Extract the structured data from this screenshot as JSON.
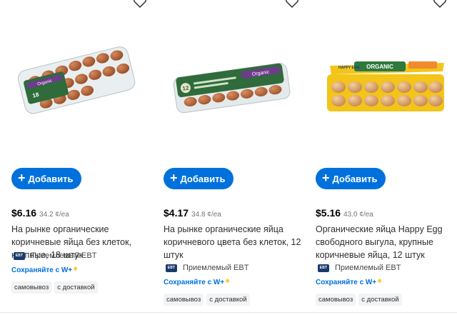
{
  "products": [
    {
      "price": "$6.16",
      "unit_price": "34.2 ¢/ea",
      "title": "На рынке органические коричневые яйца без клеток, крупные, 18 штук",
      "add_label": "Добавить",
      "ebt_badge": "EBT",
      "ebt_label": "Приемлемый EBT",
      "save_label": "Сохраняйте с W+",
      "chips": [
        "самовывоз",
        "с доставкой"
      ],
      "image": {
        "pack_label": "Organic",
        "count_label": "18"
      }
    },
    {
      "price": "$4.17",
      "unit_price": "34.8 ¢/ea",
      "title": "На рынке органические яйца коричневого цвета без клеток, 12 штук",
      "add_label": "Добавить",
      "ebt_badge": "EBT",
      "ebt_label": "Приемлемый EBT",
      "save_label": "Сохраняйте с W+",
      "chips": [
        "самовывоз",
        "с доставкой"
      ],
      "image": {
        "pack_label": "Organic",
        "count_label": "12"
      }
    },
    {
      "price": "$5.16",
      "unit_price": "43.0 ¢/ea",
      "title": "Органические яйца Happy Egg свободного выгула, крупные коричневые яйца, 12 штук",
      "add_label": "Добавить",
      "ebt_badge": "EBT",
      "ebt_label": "Приемлемый EBT",
      "save_label": "Сохраняйте с W+",
      "chips": [
        "самовывоз",
        "с доставкой"
      ],
      "image": {
        "pack_label": "ORGANIC",
        "brand_label": "HAPPY EGG"
      }
    }
  ],
  "colors": {
    "accent": "#0071dc",
    "spark": "#ffc220",
    "ebt": "#1a3a6b"
  }
}
